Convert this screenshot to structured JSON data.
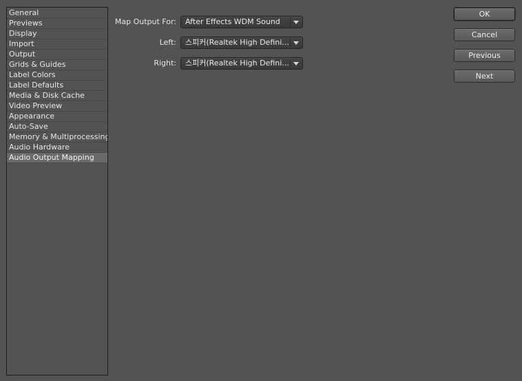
{
  "sidebar": {
    "items": [
      {
        "label": "General"
      },
      {
        "label": "Previews"
      },
      {
        "label": "Display"
      },
      {
        "label": "Import"
      },
      {
        "label": "Output"
      },
      {
        "label": "Grids & Guides"
      },
      {
        "label": "Label Colors"
      },
      {
        "label": "Label Defaults"
      },
      {
        "label": "Media & Disk Cache"
      },
      {
        "label": "Video Preview"
      },
      {
        "label": "Appearance"
      },
      {
        "label": "Auto-Save"
      },
      {
        "label": "Memory & Multiprocessing"
      },
      {
        "label": "Audio Hardware"
      },
      {
        "label": "Audio Output Mapping"
      }
    ],
    "selected_index": 14
  },
  "settings": {
    "map_output_for": {
      "label": "Map Output For:",
      "value": "After Effects WDM Sound"
    },
    "left": {
      "label": "Left:",
      "value": "스피커(Realtek High Defini..."
    },
    "right": {
      "label": "Right:",
      "value": "스피커(Realtek High Defini..."
    }
  },
  "buttons": {
    "ok": "OK",
    "cancel": "Cancel",
    "previous": "Previous",
    "next": "Next"
  },
  "colors": {
    "background": "#535353",
    "selected_item": "#6a6a6a"
  }
}
